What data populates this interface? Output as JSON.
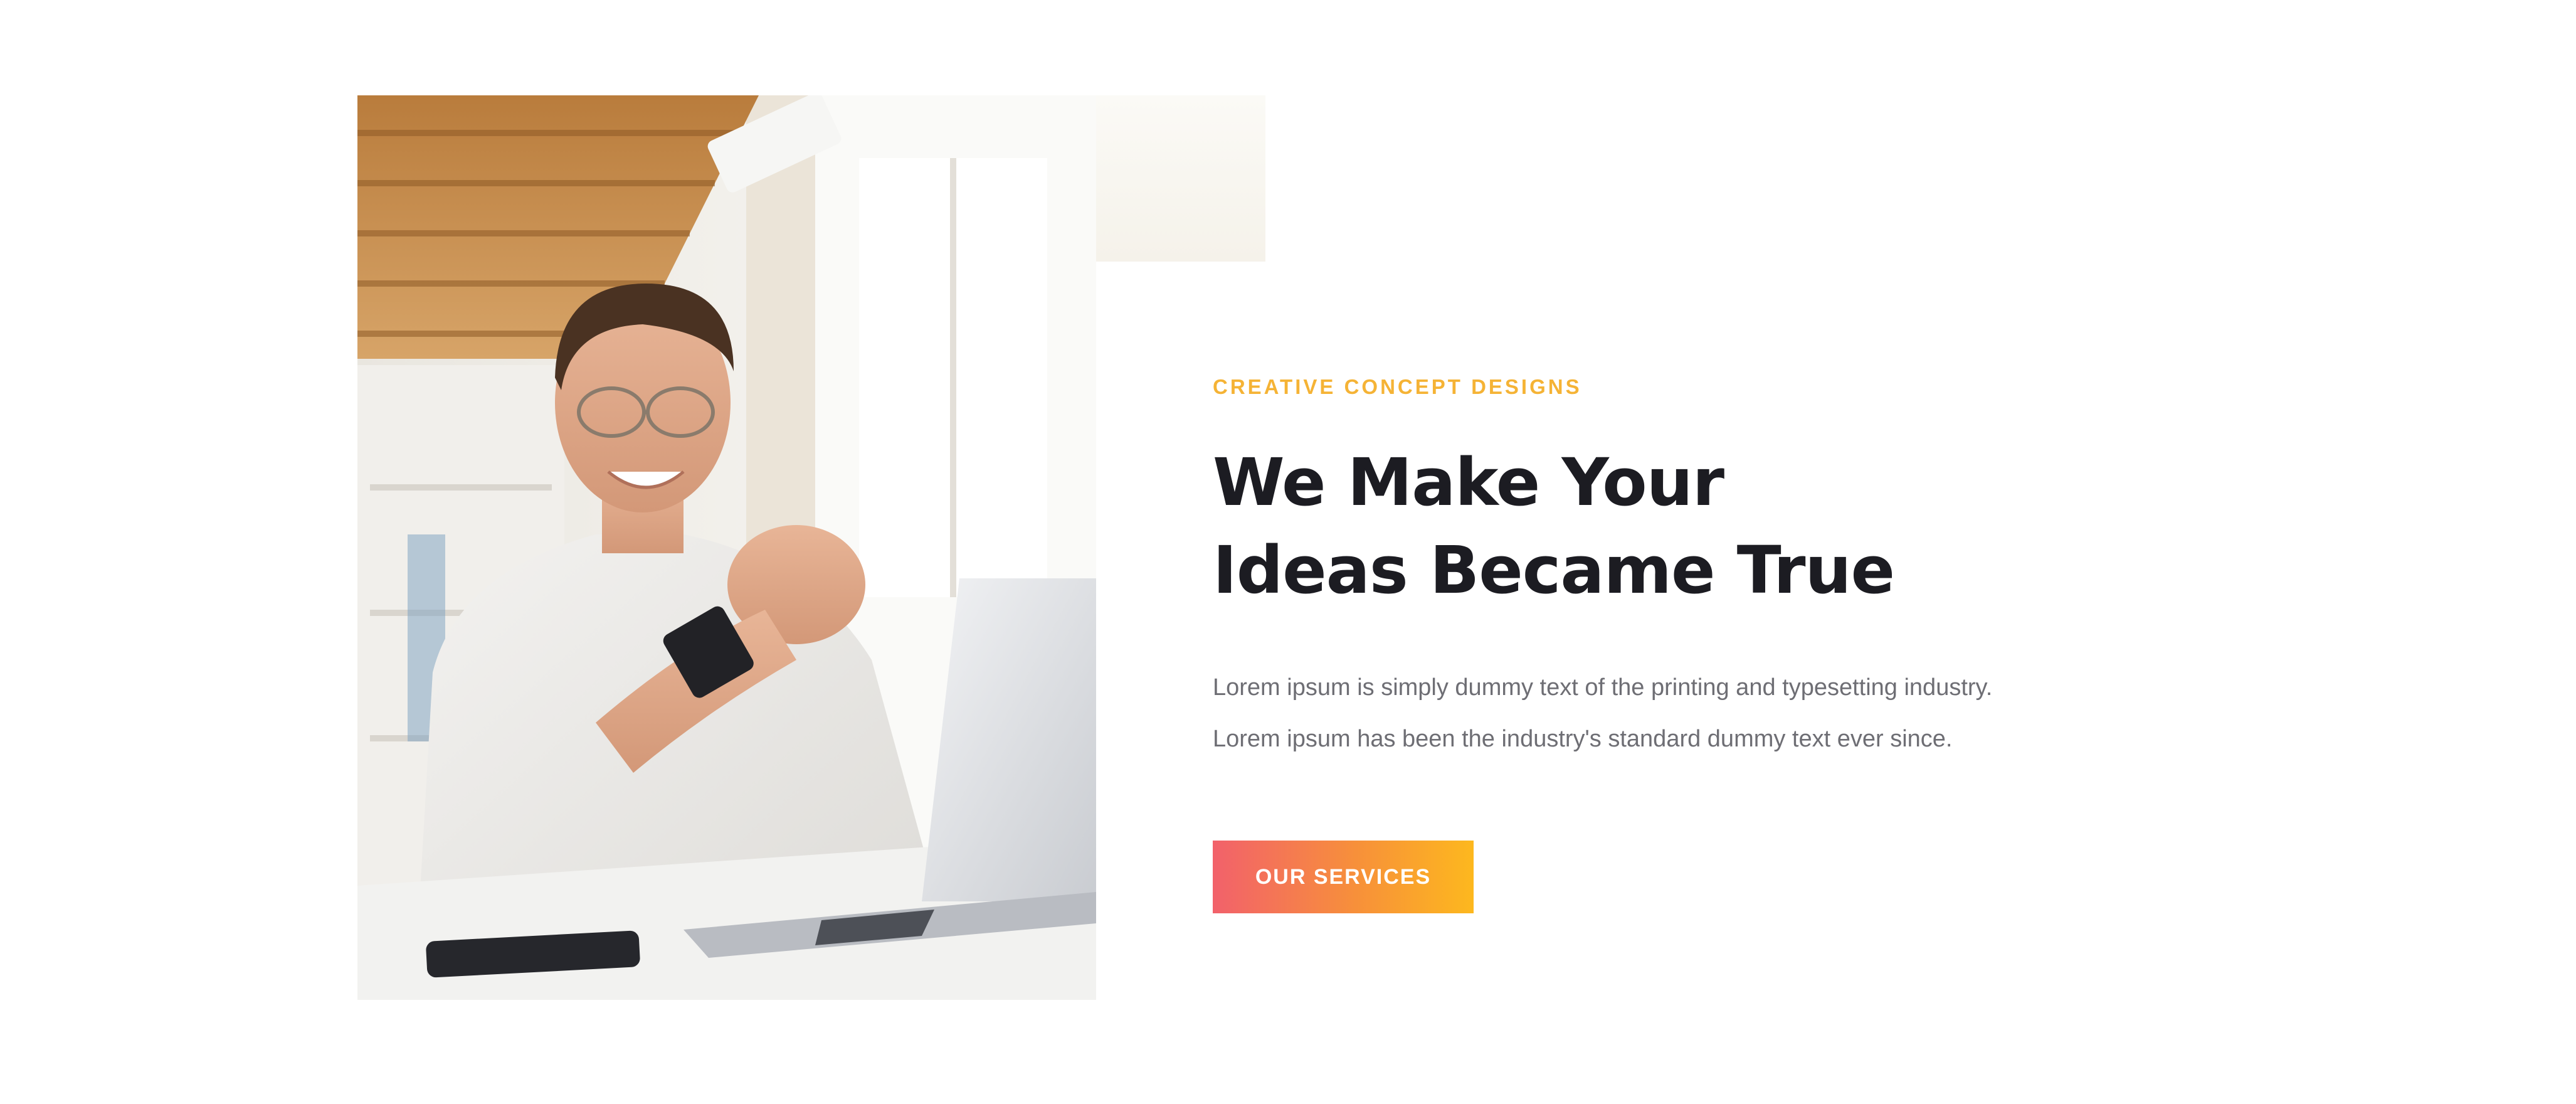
{
  "hero": {
    "eyebrow": "CREATIVE CONCEPT DESIGNS",
    "headline_line1": "We Make Your",
    "headline_line2": "Ideas Became True",
    "description_line1": "Lorem ipsum is simply dummy text of the printing and typesetting industry.",
    "description_line2": "Lorem ipsum has been the industry's standard dummy text ever since.",
    "cta_label": "OUR SERVICES",
    "photo_icon": "man-at-laptop-photo"
  },
  "colors": {
    "accent": "#f5b335",
    "heading": "#1c1c22",
    "body_text": "#6e6e74",
    "button_gradient_start": "#f2616b",
    "button_gradient_end": "#fdb81e"
  }
}
